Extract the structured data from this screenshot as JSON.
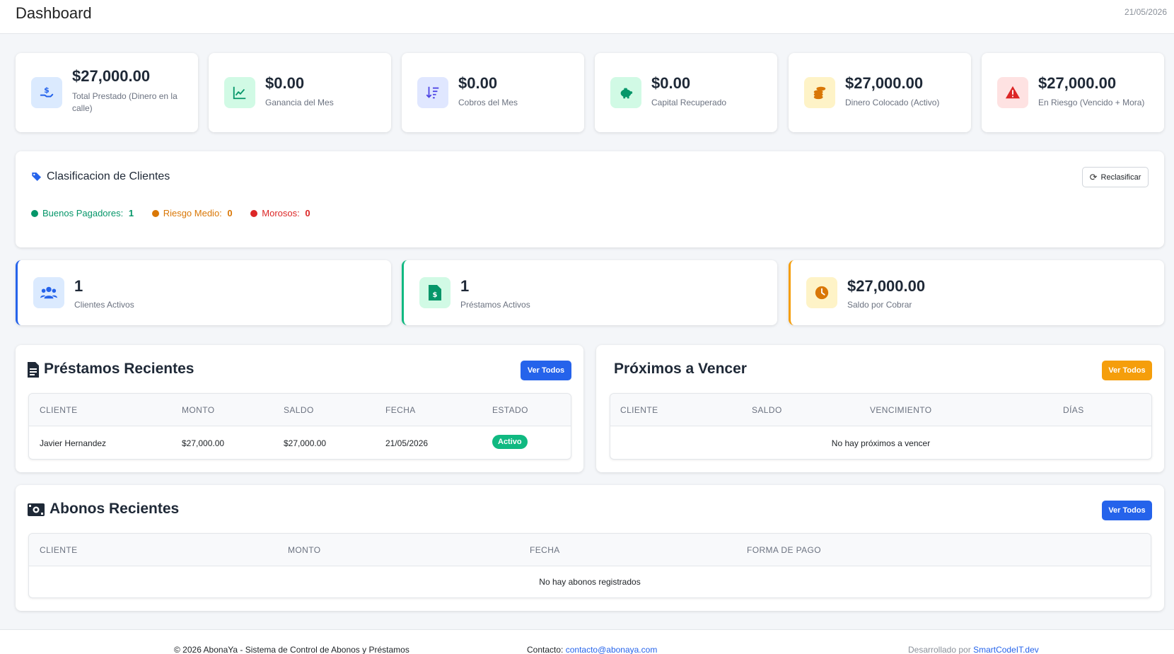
{
  "header": {
    "title": "Dashboard",
    "date": "21/05/2026"
  },
  "stats": [
    {
      "value": "$27,000.00",
      "label": "Total Prestado (Dinero en la calle)",
      "icon": "hand-dollar-icon",
      "color": "#2563eb",
      "bg": "#dbeafe"
    },
    {
      "value": "$0.00",
      "label": "Ganancia del Mes",
      "icon": "chart-line-icon",
      "color": "#059669",
      "bg": "#d1fae5"
    },
    {
      "value": "$0.00",
      "label": "Cobros del Mes",
      "icon": "sort-down-icon",
      "color": "#4f46e5",
      "bg": "#e0e7ff"
    },
    {
      "value": "$0.00",
      "label": "Capital Recuperado",
      "icon": "piggy-bank-icon",
      "color": "#059669",
      "bg": "#d1fae5"
    },
    {
      "value": "$27,000.00",
      "label": "Dinero Colocado (Activo)",
      "icon": "coins-icon",
      "color": "#d97706",
      "bg": "#fef3c7"
    },
    {
      "value": "$27,000.00",
      "label": "En Riesgo (Vencido + Mora)",
      "icon": "warning-icon",
      "color": "#dc2626",
      "bg": "#fee2e2"
    }
  ],
  "classification": {
    "title": "Clasificacion de Clientes",
    "button": "Reclasificar",
    "items": [
      {
        "label": "Buenos Pagadores:",
        "count": "1",
        "color": "#059669"
      },
      {
        "label": "Riesgo Medio:",
        "count": "0",
        "color": "#d97706"
      },
      {
        "label": "Morosos:",
        "count": "0",
        "color": "#dc2626"
      }
    ]
  },
  "summary": [
    {
      "value": "1",
      "label": "Clientes Activos",
      "icon": "users-icon",
      "color": "#2563eb",
      "bg": "#dbeafe"
    },
    {
      "value": "1",
      "label": "Préstamos Activos",
      "icon": "file-dollar-icon",
      "color": "#059669",
      "bg": "#d1fae5"
    },
    {
      "value": "$27,000.00",
      "label": "Saldo por Cobrar",
      "icon": "clock-icon",
      "color": "#d97706",
      "bg": "#fef3c7"
    }
  ],
  "recent_loans": {
    "title": "Préstamos Recientes",
    "button": "Ver Todos",
    "headers": [
      "CLIENTE",
      "MONTO",
      "SALDO",
      "FECHA",
      "ESTADO"
    ],
    "rows": [
      {
        "cliente": "Javier Hernandez",
        "monto": "$27,000.00",
        "saldo": "$27,000.00",
        "fecha": "21/05/2026",
        "estado": "Activo"
      }
    ]
  },
  "upcoming": {
    "title": "Próximos a Vencer",
    "button": "Ver Todos",
    "headers": [
      "CLIENTE",
      "SALDO",
      "VENCIMIENTO",
      "DÍAS"
    ],
    "empty": "No hay próximos a vencer"
  },
  "payments": {
    "title": "Abonos Recientes",
    "button": "Ver Todos",
    "headers": [
      "CLIENTE",
      "MONTO",
      "FECHA",
      "FORMA DE PAGO"
    ],
    "empty": "No hay abonos registrados"
  },
  "footer": {
    "copyright": "© 2026 AbonaYa - Sistema de Control de Abonos y Préstamos",
    "contact_label": "Contacto:",
    "contact_email": "contacto@abonaya.com",
    "dev_label": "Desarrollado por",
    "dev_name": "SmartCodeIT.dev"
  },
  "colors": {
    "primary": "#2563eb",
    "success": "#10b981",
    "warning": "#f59e0b",
    "danger": "#dc2626"
  }
}
